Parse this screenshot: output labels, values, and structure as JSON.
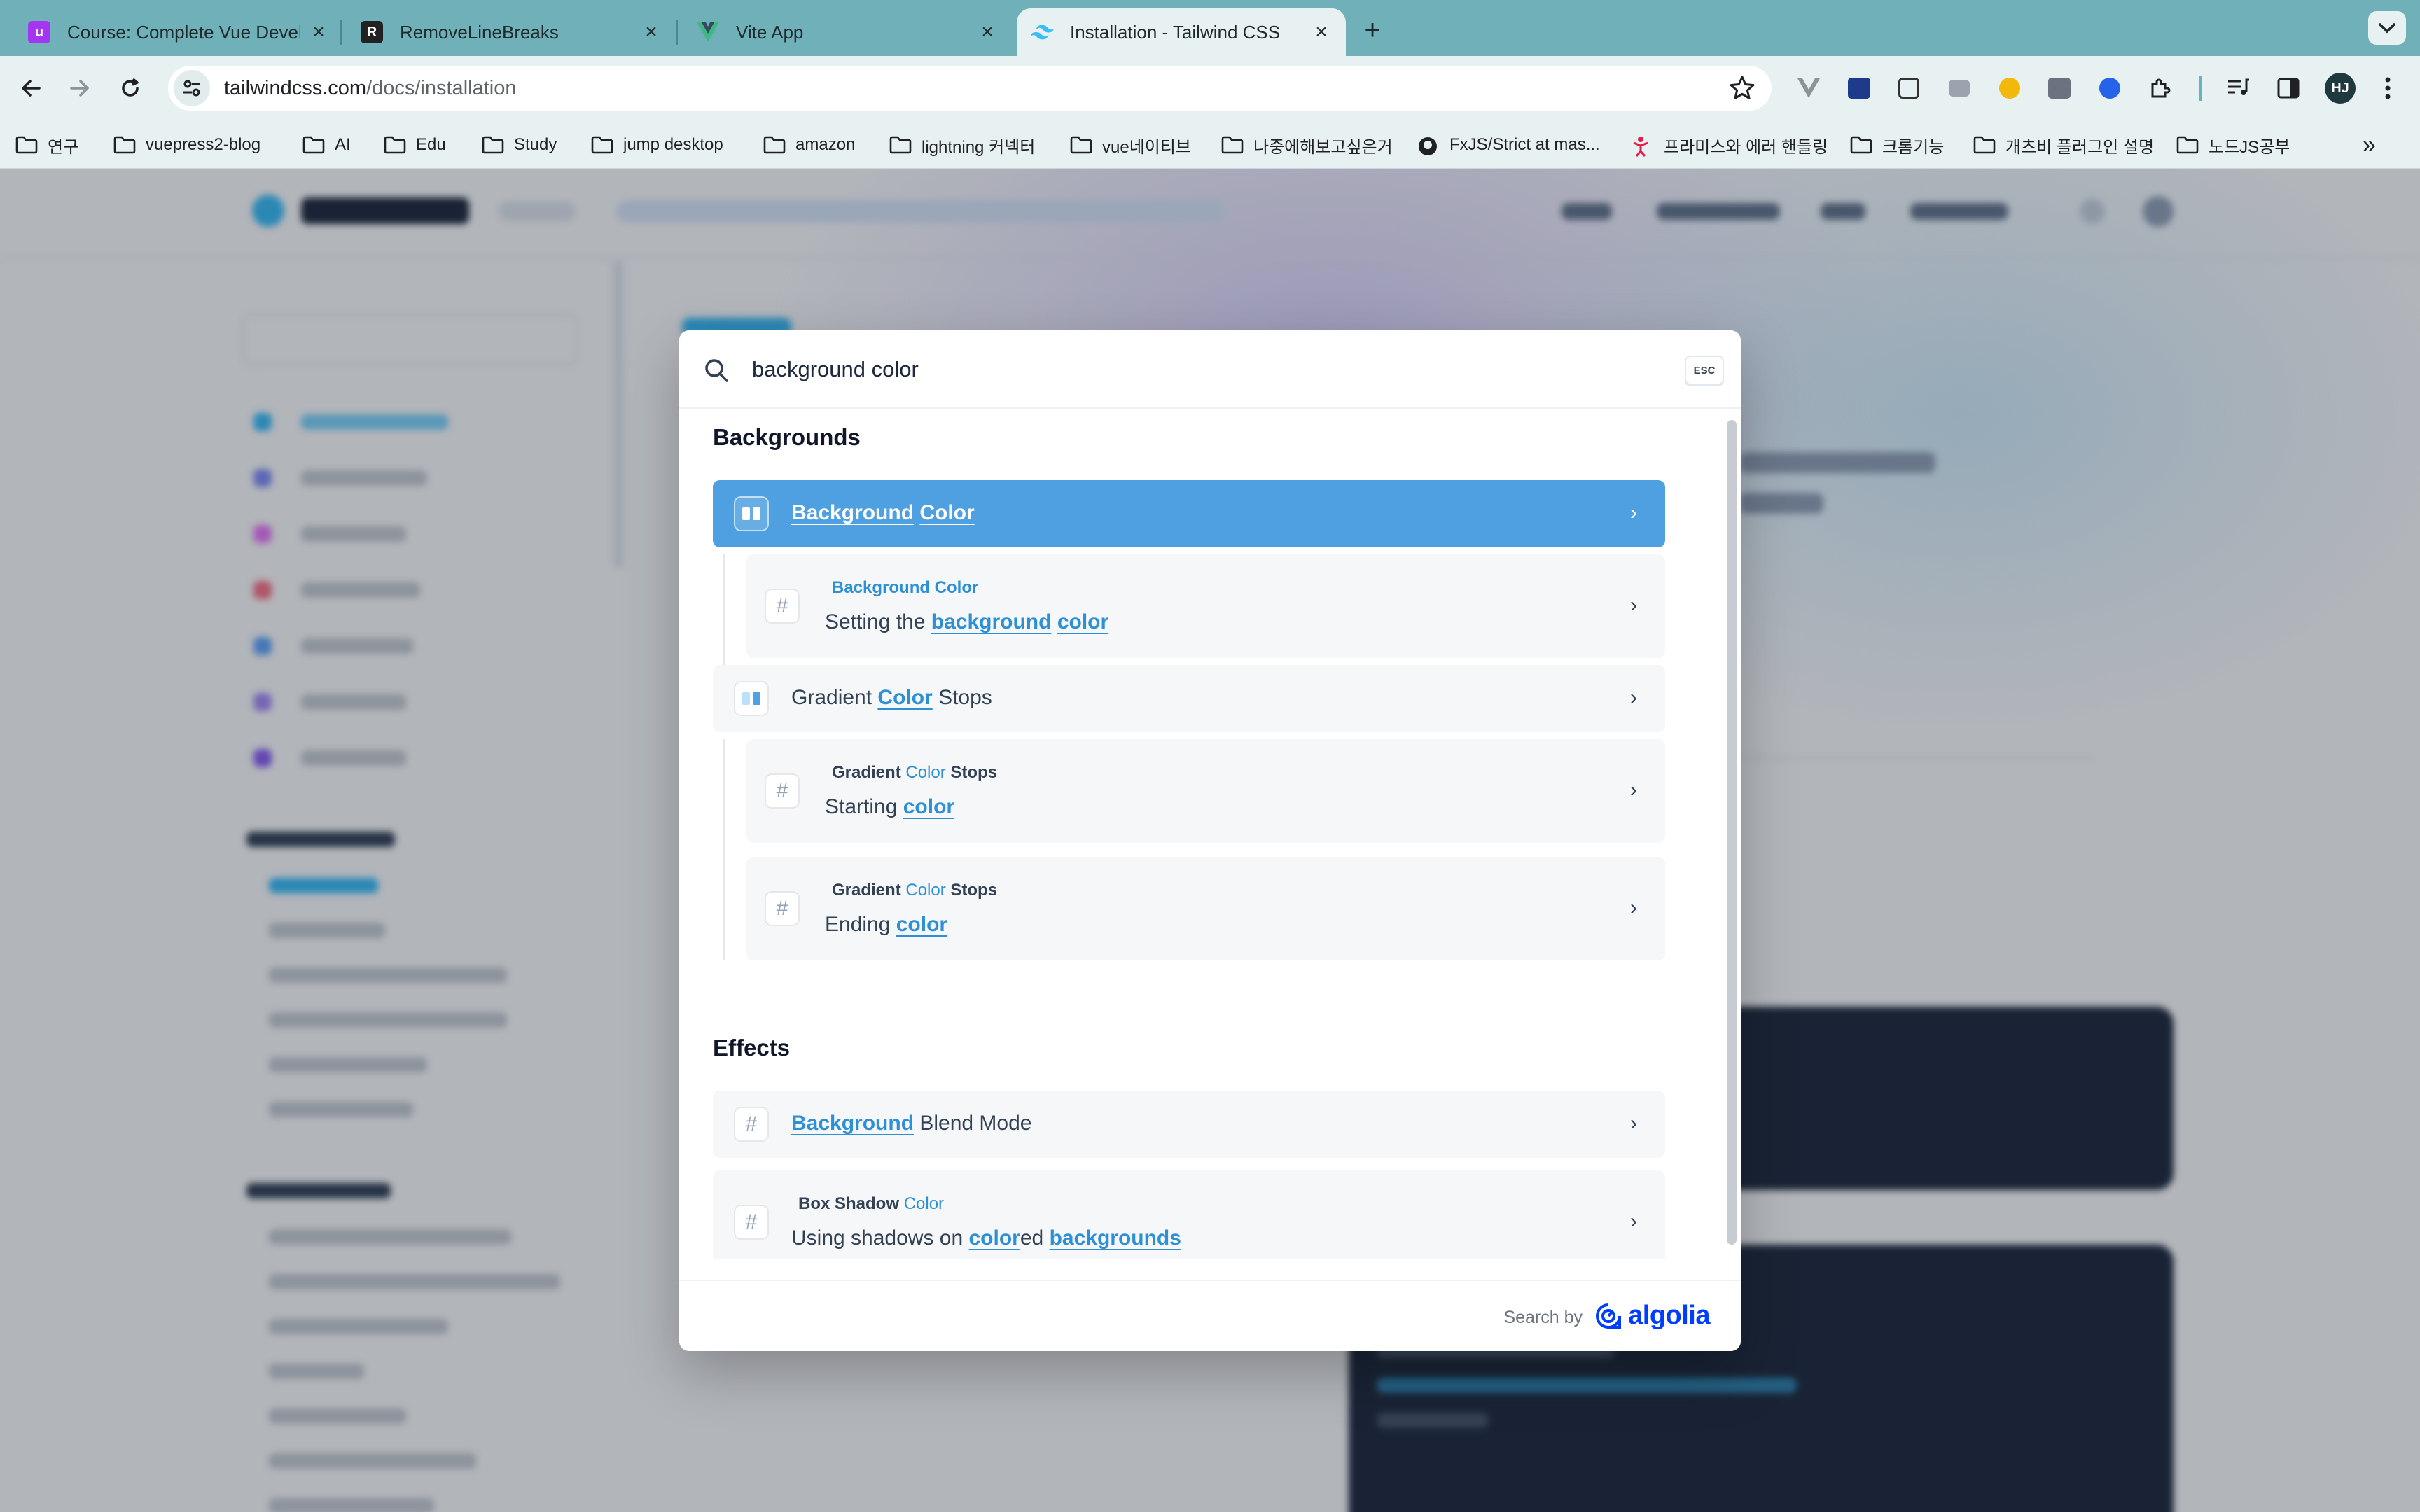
{
  "browser": {
    "tabs": [
      {
        "title": "Course: Complete Vue Develo",
        "favicon": "udemy-icon",
        "active": false
      },
      {
        "title": "RemoveLineBreaks",
        "favicon": "r-icon",
        "active": false
      },
      {
        "title": "Vite App",
        "favicon": "vue-icon",
        "active": false
      },
      {
        "title": "Installation - Tailwind CSS",
        "favicon": "tailwind-icon",
        "active": true
      }
    ],
    "url_host": "tailwindcss.com",
    "url_path": "/docs/installation",
    "profile_initials": "HJ",
    "bookmarks": [
      "연구",
      "vuepress2-blog",
      "AI",
      "Edu",
      "Study",
      "jump desktop",
      "amazon",
      "lightning 커넥터",
      "vue네이티브",
      "나중에해보고싶은거",
      "FxJS/Strict at mas...",
      "프라미스와 에러 핸들링",
      "크롬기능",
      "개츠비 플러그인 설명",
      "노드JS공부"
    ]
  },
  "search": {
    "query": "background color",
    "esc_label": "ESC",
    "sections": [
      {
        "title": "Backgrounds"
      },
      {
        "title": "Effects"
      }
    ],
    "hits": {
      "bg_color": {
        "w1": "Background",
        "sp": " ",
        "w2": "Color"
      },
      "bg_color_sub": {
        "crumb": "Background Color",
        "pre": "Setting the ",
        "w1": "background",
        "sp": " ",
        "w2": "color"
      },
      "gradient": {
        "pre": "Gradient ",
        "w1": "Color",
        "post": " Stops"
      },
      "gradient_start": {
        "crumb_pre": "Gradient ",
        "crumb_hl": "Color",
        "crumb_post": " Stops",
        "pre": "Starting ",
        "w1": "color"
      },
      "gradient_end": {
        "crumb_pre": "Gradient ",
        "crumb_hl": "Color",
        "crumb_post": " Stops",
        "pre": "Ending ",
        "w1": "color"
      },
      "blend": {
        "w1": "Background",
        "post": " Blend Mode"
      },
      "shadow": {
        "crumb_pre": "Box Shadow ",
        "crumb_hl": "Color",
        "pre": "Using shadows on ",
        "w1": "color",
        "mid": "ed ",
        "w2": "backgrounds"
      }
    },
    "footer": {
      "search_by": "Search by",
      "brand": "algolia"
    }
  },
  "colors": {
    "accent": "#4ea0e0",
    "highlight": "#2d8fd5",
    "algolia": "#003dff",
    "tabstrip": "#6fb0b9"
  }
}
